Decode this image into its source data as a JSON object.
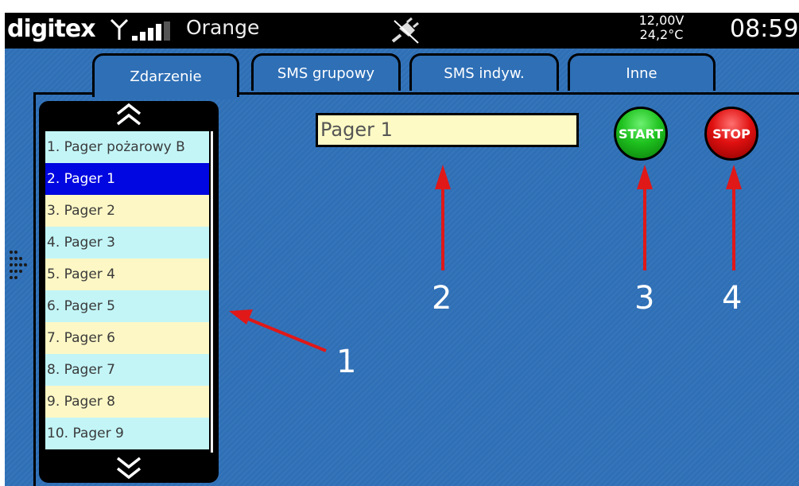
{
  "status_bar": {
    "brand": "digitex",
    "operator": "Orange",
    "voltage": "12,00V",
    "temperature": "24,2°C",
    "time": "08:59",
    "icons": [
      "antenna-icon",
      "signal-bars-icon",
      "power-plug-disconnected-icon"
    ]
  },
  "tabs": [
    {
      "label": "Zdarzenie",
      "active": true
    },
    {
      "label": "SMS grupowy",
      "active": false
    },
    {
      "label": "SMS indyw.",
      "active": false
    },
    {
      "label": "Inne",
      "active": false
    }
  ],
  "pager_list": {
    "scroll_up_icon": "double-chevron-up-icon",
    "scroll_down_icon": "double-chevron-down-icon",
    "selected_index": 1,
    "items": [
      "1. Pager pożarowy B",
      "2. Pager 1",
      "3. Pager 2",
      "4. Pager 3",
      "5. Pager 4",
      "6. Pager 5",
      "7. Pager 6",
      "8. Pager 7",
      "9. Pager 8",
      "10. Pager 9"
    ]
  },
  "selected_pager_field": {
    "value": "Pager 1"
  },
  "buttons": {
    "start_label": "START",
    "stop_label": "STOP"
  },
  "annotations": {
    "label_1": "1",
    "label_2": "2",
    "label_3": "3",
    "label_4": "4"
  },
  "colors": {
    "background": "#2e6fb6",
    "selected_item": "#0007e0",
    "item_yellow": "#fdf7c5",
    "item_cyan": "#c3f5f7",
    "field_bg": "#fdfac5",
    "start_green": "#1fc21f",
    "stop_red": "#e01010",
    "arrow_red": "#e01818"
  }
}
